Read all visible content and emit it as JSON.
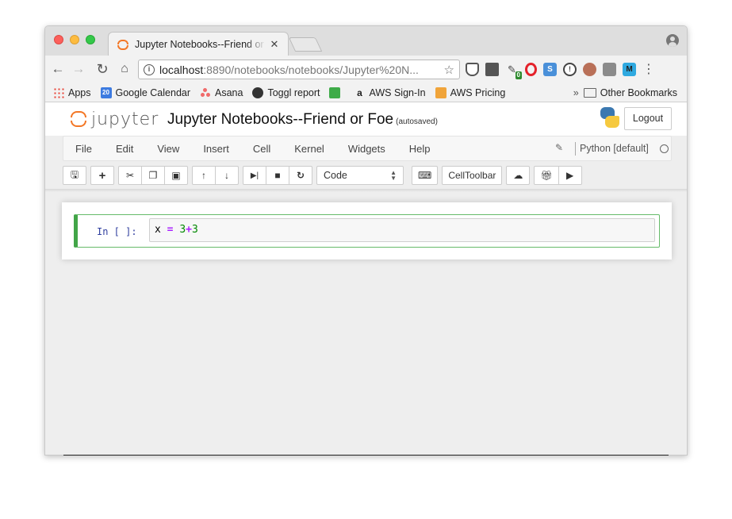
{
  "browser": {
    "tab_title": "Jupyter Notebooks--Friend or Foe",
    "tab_close": "✕",
    "address": {
      "host": "localhost",
      "rest": ":8890/notebooks/notebooks/Jupyter%20N..."
    },
    "extensions": {
      "badge_count": "0"
    },
    "bookmarks": [
      {
        "label": "Apps",
        "icon": "apps-icon"
      },
      {
        "label": "Google Calendar",
        "icon": "calendar-icon",
        "icon_text": "20"
      },
      {
        "label": "Asana",
        "icon": "asana-icon"
      },
      {
        "label": "Toggl report",
        "icon": "toggl-icon"
      },
      {
        "label": "",
        "icon": "evernote-icon"
      },
      {
        "label": "AWS Sign-In",
        "icon": "amazon-icon",
        "icon_text": "a"
      },
      {
        "label": "AWS Pricing",
        "icon": "aws-icon"
      }
    ],
    "bookmarks_more": "»",
    "other_bookmarks": "Other Bookmarks"
  },
  "jupyter": {
    "logo_text": "jupyter",
    "notebook_title": "Jupyter Notebooks--Friend or Foe",
    "autosave_status": "(autosaved)",
    "logout_label": "Logout",
    "menu": [
      "File",
      "Edit",
      "View",
      "Insert",
      "Cell",
      "Kernel",
      "Widgets",
      "Help"
    ],
    "kernel_name": "Python [default]",
    "cell_type_selected": "Code",
    "celltoolbar_label": "CellToolbar",
    "cell": {
      "prompt": "In [ ]:",
      "code_var": "x",
      "code_eq": "=",
      "code_a": "3",
      "code_op": "+",
      "code_b": "3"
    }
  },
  "colors": {
    "jupyter_orange": "#f37726",
    "cell_selected_border": "#42a548",
    "prompt_blue": "#303f9f"
  }
}
